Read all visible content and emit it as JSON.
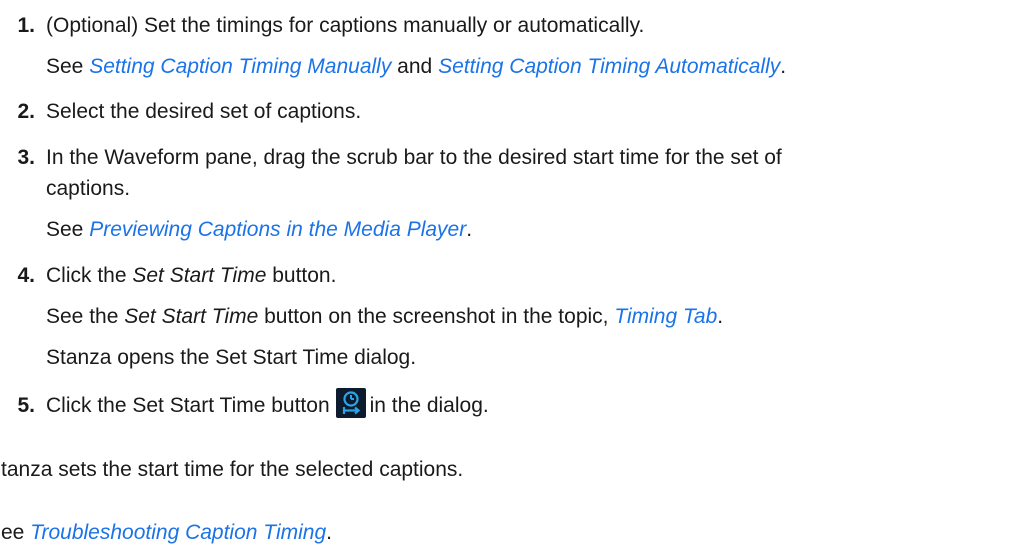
{
  "steps": [
    {
      "number": "1.",
      "text": "(Optional) Set the timings for captions manually or automatically.",
      "see_prefix": "See ",
      "link1": "Setting Caption Timing Manually",
      "and": " and ",
      "link2": "Setting Caption Timing Automatically",
      "end": "."
    },
    {
      "number": "2.",
      "text": "Select the desired set of captions."
    },
    {
      "number": "3.",
      "text_line1": "In the Waveform pane, drag the scrub bar to the desired start time for the set of",
      "text_line2": "captions.",
      "see_prefix": "See ",
      "link": "Previewing Captions in the Media Player",
      "end": "."
    },
    {
      "number": "4.",
      "text_pre": "Click the ",
      "text_em": "Set Start Time",
      "text_post": " button.",
      "see_pre": "See the ",
      "see_em": "Set Start Time",
      "see_mid": " button on the screenshot in the topic, ",
      "see_link": "Timing Tab",
      "see_end": ".",
      "result": "Stanza opens the Set Start Time dialog."
    },
    {
      "number": "5.",
      "text_pre": "Click the Set Start Time button",
      "icon": "set-start-time-icon",
      "text_post": "in the dialog."
    }
  ],
  "result": "Stanza sets the start time for the selected captions.",
  "see_also": {
    "prefix": "See ",
    "link": "Troubleshooting Caption Timing",
    "end": "."
  },
  "colors": {
    "link": "#1a73e8",
    "icon_bg": "#0d1b2e",
    "icon_fg": "#2aa6e8"
  }
}
